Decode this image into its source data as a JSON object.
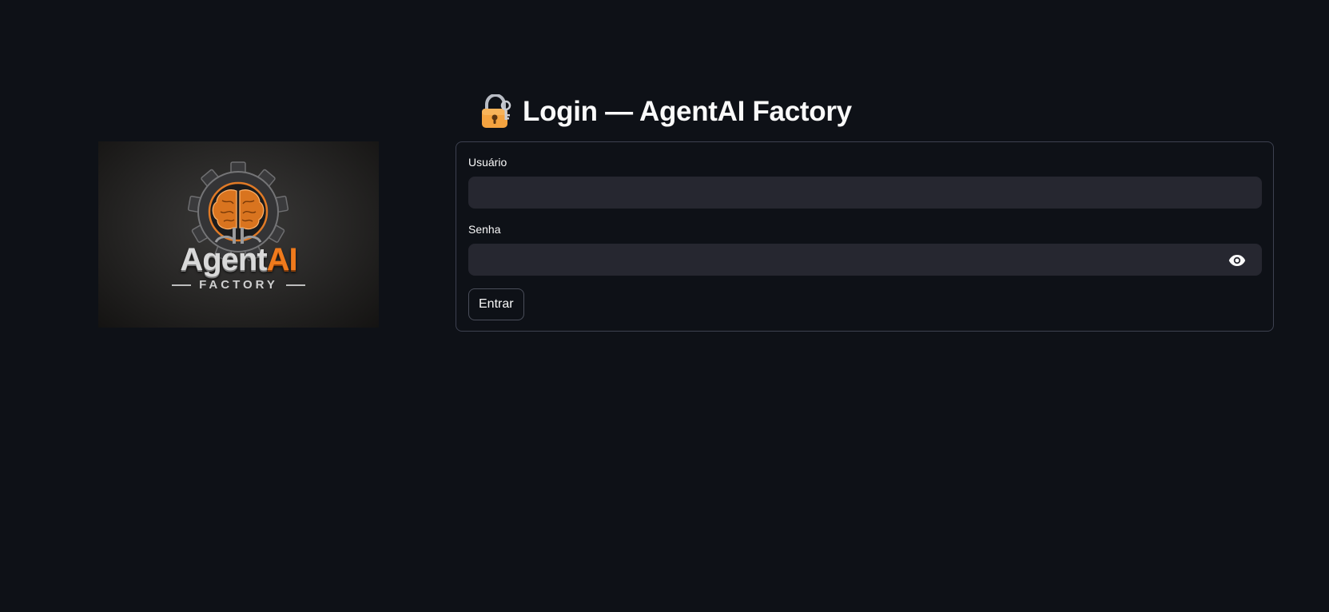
{
  "logo": {
    "brand_primary": "Agent",
    "brand_accent": "AI",
    "brand_sub": "FACTORY",
    "icon": "gear-brain-icon",
    "accent_color": "#f07a1c"
  },
  "header": {
    "icon": "lock-with-key-icon",
    "title": "Login — AgentAI Factory"
  },
  "form": {
    "username": {
      "label": "Usuário",
      "value": ""
    },
    "password": {
      "label": "Senha",
      "value": "",
      "toggle_icon": "eye-icon"
    },
    "submit_label": "Entrar"
  },
  "colors": {
    "background": "#0e1117",
    "input_background": "#262730",
    "border": "#3d4150",
    "text": "#fafafa"
  }
}
